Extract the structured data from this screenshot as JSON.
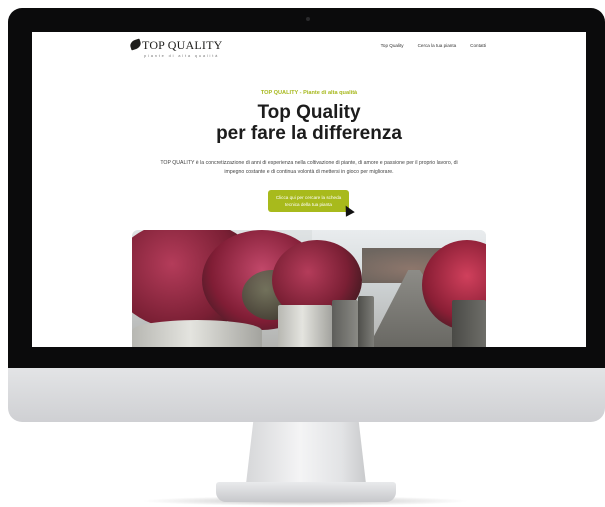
{
  "site": {
    "logo": {
      "name": "TOP QUALITY",
      "tagline": "piante di alta qualità"
    },
    "nav": [
      {
        "label": "Top Quality"
      },
      {
        "label": "Cerca la tua pianta"
      },
      {
        "label": "Contatti"
      }
    ],
    "eyebrow": "TOP QUALITY - Piante di alta qualità",
    "headline_line1": "Top Quality",
    "headline_line2": "per fare la differenza",
    "intro": "TOP QUALITY è la concretizzazione di anni di esperienza nella coltivazione di piante, di amore e passione per il proprio lavoro, di impegno costante e di continua volontà di mettersi in gioco per migliorare.",
    "cta_label": "Clicca qui per cercare la scheda tecnica della tua pianta"
  },
  "colors": {
    "accent": "#a8ba1c",
    "headline": "#1c1c1c",
    "monitor_bezel": "#0b0b0c",
    "monitor_chin": "#d9dadc"
  },
  "icons": {
    "cursor": "mouse-pointer-icon",
    "logo_mark": "leaf-icon"
  }
}
